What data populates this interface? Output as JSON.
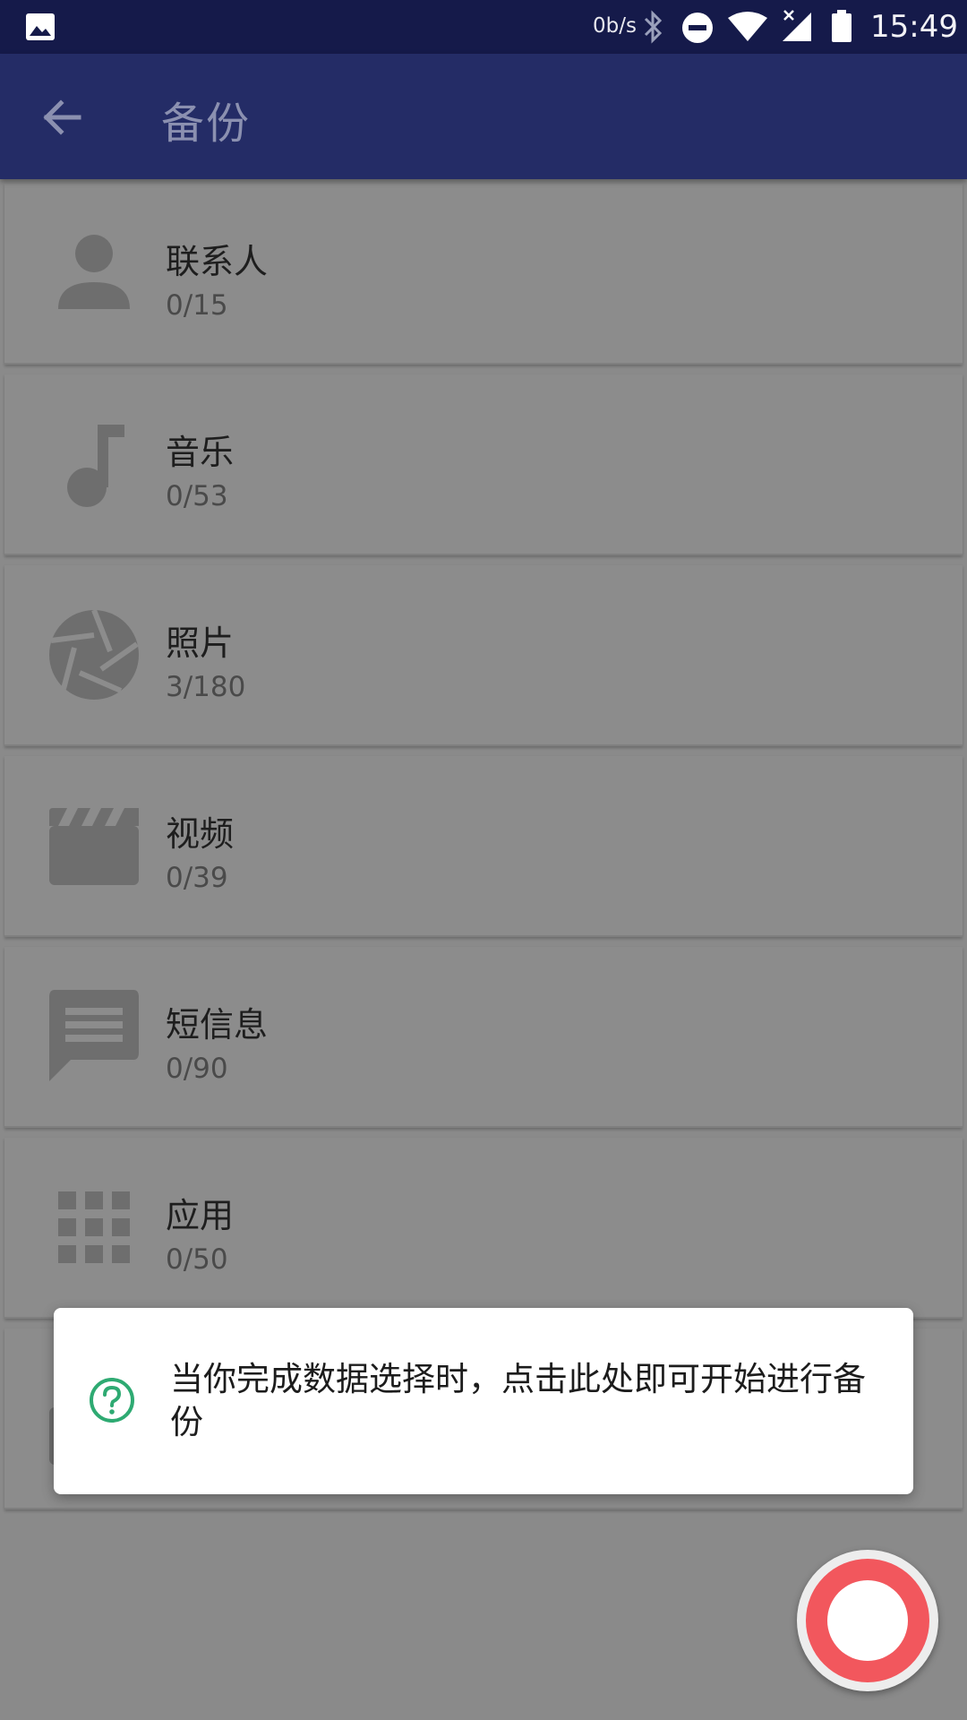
{
  "status_bar": {
    "net_speed": "0b/s",
    "time": "15:49",
    "icons": [
      "gallery-icon",
      "bluetooth-icon",
      "do-not-disturb-icon",
      "wifi-icon",
      "signal-icon",
      "battery-icon"
    ]
  },
  "app_bar": {
    "title": "备份",
    "back_icon": "arrow-left-icon"
  },
  "items": [
    {
      "label": "联系人",
      "count": "0/15",
      "icon": "person-icon"
    },
    {
      "label": "音乐",
      "count": "0/53",
      "icon": "music-note-icon"
    },
    {
      "label": "照片",
      "count": "3/180",
      "icon": "camera-aperture-icon"
    },
    {
      "label": "视频",
      "count": "0/39",
      "icon": "clapperboard-icon"
    },
    {
      "label": "短信息",
      "count": "0/90",
      "icon": "message-icon"
    },
    {
      "label": "应用",
      "count": "0/50",
      "icon": "apps-grid-icon"
    }
  ],
  "tooltip": {
    "text": "当你完成数据选择时，点击此处即可开始进行备份",
    "icon": "help-circle-icon",
    "icon_color": "#2eaa72"
  },
  "fab": {
    "icon": "record-icon",
    "color": "#f2575d"
  },
  "colors": {
    "status_bar": "#151a4a",
    "app_bar": "#242c66",
    "dim_overlay": "#8a8a8a"
  }
}
